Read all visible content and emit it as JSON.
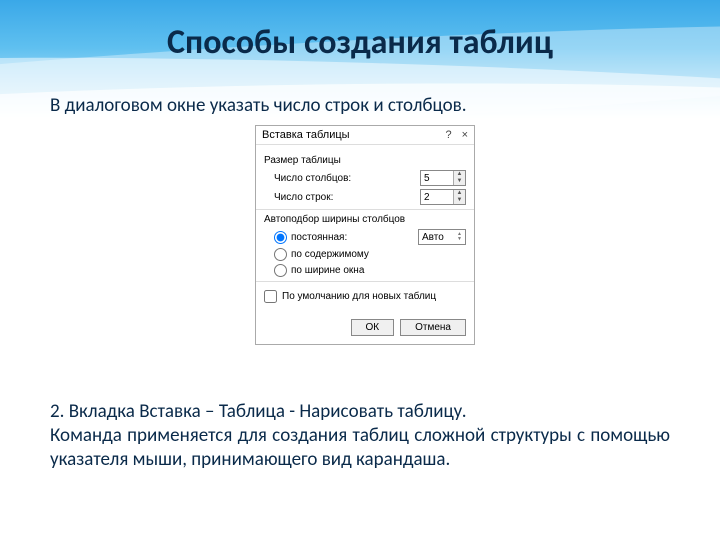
{
  "slide": {
    "title": "Способы создания таблиц",
    "intro": "В диалоговом окне указать число строк и столбцов.",
    "para2_line1": "2. Вкладка Вставка – Таблица - Нарисовать таблицу.",
    "para2_rest": "Команда применяется для создания таблиц сложной структуры с помощью указателя мыши, принимающего вид карандаша."
  },
  "dialog": {
    "title": "Вставка таблицы",
    "help": "?",
    "close": "×",
    "section_size": "Размер таблицы",
    "cols_label": "Число столбцов:",
    "cols_value": "5",
    "rows_label": "Число строк:",
    "rows_value": "2",
    "section_autofit": "Автоподбор ширины столбцов",
    "opt_fixed": "постоянная:",
    "opt_fixed_value": "Авто",
    "opt_content": "по содержимому",
    "opt_window": "по ширине окна",
    "remember": "По умолчанию для новых таблиц",
    "ok": "ОК",
    "cancel": "Отмена"
  }
}
